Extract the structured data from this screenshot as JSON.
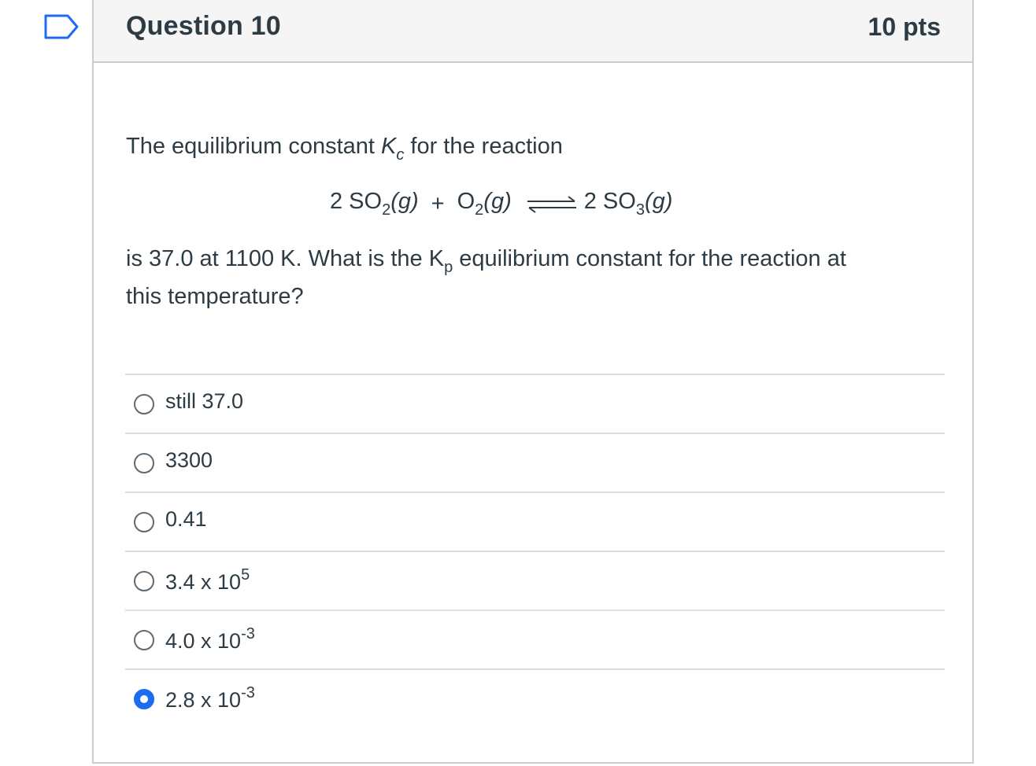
{
  "question": {
    "title": "Question 10",
    "points": "10 pts"
  },
  "body": {
    "intro_pre": "The equilibrium constant ",
    "k_symbol": "K",
    "k_sub": "c",
    "intro_post": " for the reaction",
    "equation": {
      "left_coef": "2 SO",
      "left_sub": "2",
      "left_state": "(g)",
      "plus": "+",
      "o2": "O",
      "o2_sub": "2",
      "o2_state": "(g)",
      "right_coef": "2 SO",
      "right_sub": "3",
      "right_state": "(g)"
    },
    "line2_pre": "is 37.0 at 1100 K.  What is the K",
    "line2_sub": "p",
    "line2_post": " equilibrium constant for the reaction at",
    "line3": "this temperature?"
  },
  "answers": [
    {
      "base": "still 37.0",
      "exp": "",
      "selected": false
    },
    {
      "base": "3300",
      "exp": "",
      "selected": false
    },
    {
      "base": "0.41",
      "exp": "",
      "selected": false
    },
    {
      "base": "3.4 x 10",
      "exp": "5",
      "selected": false
    },
    {
      "base": "4.0 x 10",
      "exp": "-3",
      "selected": false
    },
    {
      "base": "2.8 x 10",
      "exp": "-3",
      "selected": true
    }
  ],
  "colors": {
    "accent": "#1c6cf2",
    "text": "#2d3b45",
    "border": "#c7cdd1",
    "header_bg": "#f5f5f5"
  }
}
